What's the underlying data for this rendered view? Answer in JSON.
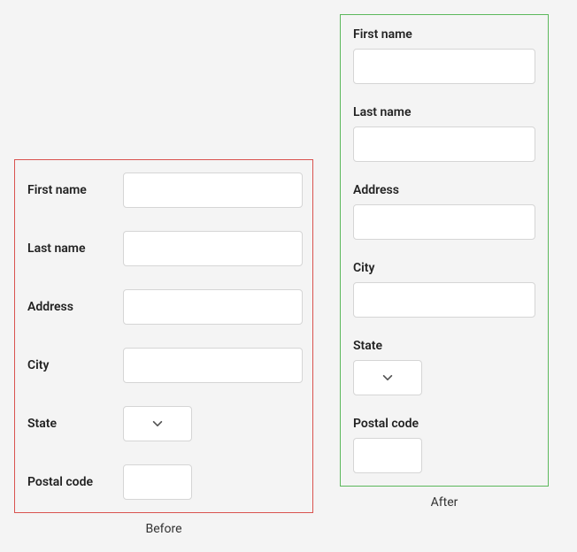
{
  "before": {
    "caption": "Before",
    "fields": {
      "first_name": {
        "label": "First name",
        "value": ""
      },
      "last_name": {
        "label": "Last name",
        "value": ""
      },
      "address": {
        "label": "Address",
        "value": ""
      },
      "city": {
        "label": "City",
        "value": ""
      },
      "state": {
        "label": "State",
        "value": ""
      },
      "postal_code": {
        "label": "Postal code",
        "value": ""
      }
    }
  },
  "after": {
    "caption": "After",
    "fields": {
      "first_name": {
        "label": "First name",
        "value": ""
      },
      "last_name": {
        "label": "Last name",
        "value": ""
      },
      "address": {
        "label": "Address",
        "value": ""
      },
      "city": {
        "label": "City",
        "value": ""
      },
      "state": {
        "label": "State",
        "value": ""
      },
      "postal_code": {
        "label": "Postal code",
        "value": ""
      }
    }
  }
}
